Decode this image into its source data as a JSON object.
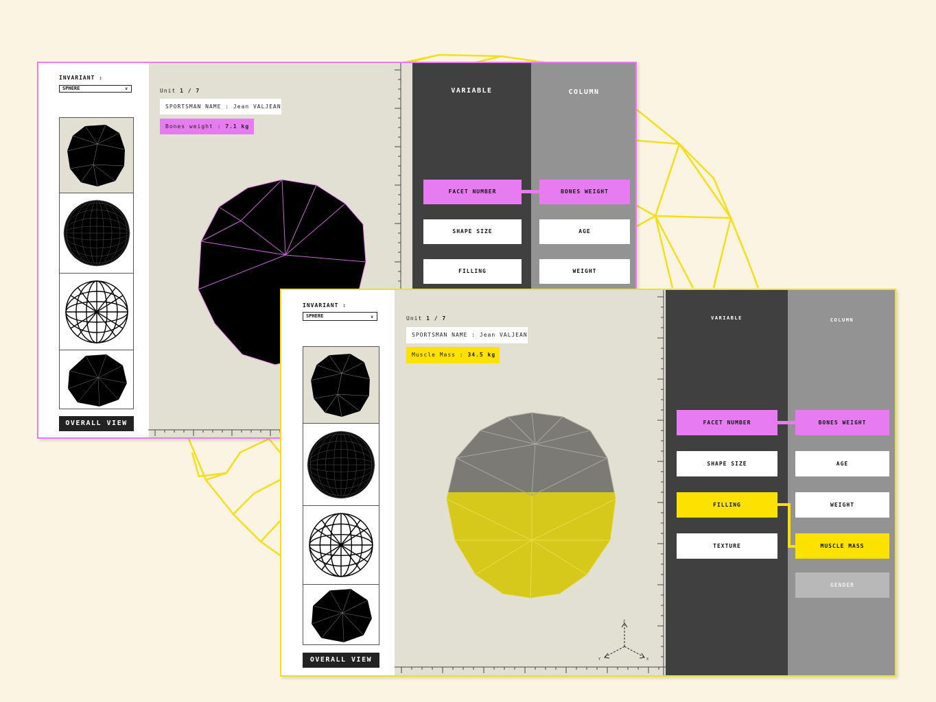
{
  "colors": {
    "background": "#fbf4e3",
    "accent_pink": "#e77cf0",
    "accent_yellow": "#fbe200",
    "canvas": "#e2e0d3",
    "variable_column": "#404040",
    "column_column": "#939393"
  },
  "window_a": {
    "invariant_label": "INVARIANT :",
    "shape_select": "SPHERE",
    "thumbnails": [
      "low-poly-sphere-icon",
      "dense-wireframe-sphere-icon",
      "geodesic-wireframe-sphere-icon",
      "faceted-polyhedron-icon"
    ],
    "overall_view": "OVERALL VIEW",
    "unit_label": "Unit",
    "unit_value": "1 / 7",
    "sportsman_label": "SPORTSMAN NAME : Jean VALJEAN",
    "value_label": "Bones weight :",
    "value_amount": "7.1 kg",
    "variable_header": "VARIABLE",
    "column_header": "COLUMN",
    "variables": [
      "FACET NUMBER",
      "SHAPE SIZE",
      "FILLING"
    ],
    "columns": [
      "BONES WEIGHT",
      "AGE",
      "WEIGHT"
    ]
  },
  "window_b": {
    "invariant_label": "INVARIANT :",
    "shape_select": "SPHERE",
    "thumbnails": [
      "low-poly-sphere-icon",
      "dense-wireframe-sphere-icon",
      "geodesic-wireframe-sphere-icon",
      "faceted-polyhedron-icon"
    ],
    "overall_view": "OVERALL VIEW",
    "unit_label": "Unit",
    "unit_value": "1 / 7",
    "sportsman_label": "SPORTSMAN NAME : Jean VALJEAN",
    "value_label": "Muscle Mass :",
    "value_amount": "34.5 kg",
    "variable_header": "VARIABLE",
    "column_header": "COLUMN",
    "variables": [
      "FACET NUMBER",
      "SHAPE SIZE",
      "FILLING",
      "TEXTURE"
    ],
    "columns": [
      "BONES WEIGHT",
      "AGE",
      "WEIGHT",
      "MUSCLE MASS",
      "GENDER"
    ],
    "axis_labels": {
      "z": "Z",
      "y": "Y",
      "x": "X"
    }
  }
}
